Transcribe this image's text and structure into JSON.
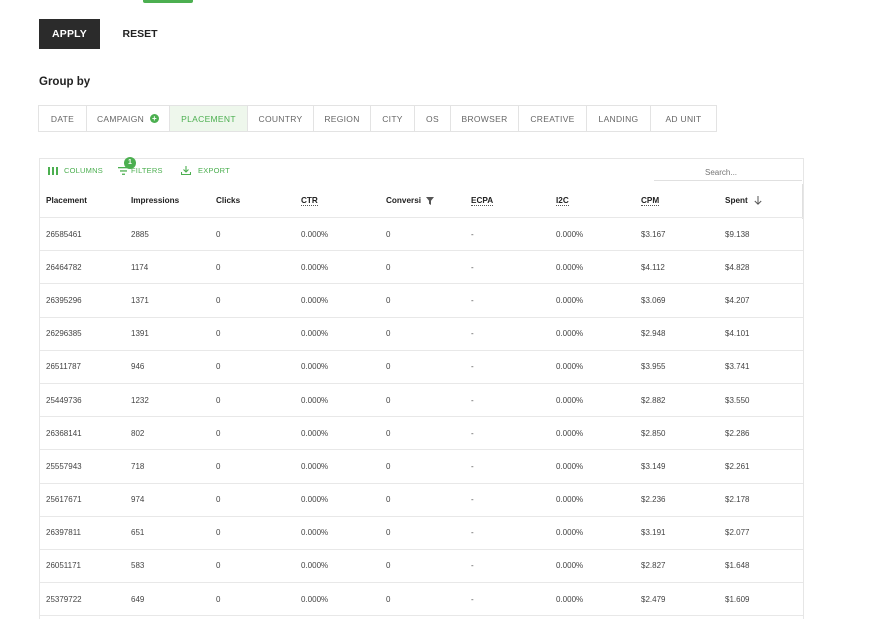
{
  "actions": {
    "apply": "APPLY",
    "reset": "RESET"
  },
  "group_by": {
    "label": "Group by",
    "tabs": [
      "DATE",
      "CAMPAIGN",
      "PLACEMENT",
      "COUNTRY",
      "REGION",
      "CITY",
      "OS",
      "BROWSER",
      "CREATIVE",
      "LANDING",
      "AD UNIT"
    ],
    "active": "PLACEMENT"
  },
  "toolbar": {
    "columns": "COLUMNS",
    "filters": "FILTERS",
    "filters_badge": "1",
    "export": "EXPORT",
    "search_placeholder": "Search..."
  },
  "table": {
    "headers": [
      "Placement",
      "Impressions",
      "Clicks",
      "CTR",
      "Conversi",
      "ECPA",
      "I2C",
      "CPM",
      "Spent"
    ],
    "rows": [
      [
        "26585461",
        "2885",
        "0",
        "0.000%",
        "0",
        "-",
        "0.000%",
        "$3.167",
        "$9.138"
      ],
      [
        "26464782",
        "1174",
        "0",
        "0.000%",
        "0",
        "-",
        "0.000%",
        "$4.112",
        "$4.828"
      ],
      [
        "26395296",
        "1371",
        "0",
        "0.000%",
        "0",
        "-",
        "0.000%",
        "$3.069",
        "$4.207"
      ],
      [
        "26296385",
        "1391",
        "0",
        "0.000%",
        "0",
        "-",
        "0.000%",
        "$2.948",
        "$4.101"
      ],
      [
        "26511787",
        "946",
        "0",
        "0.000%",
        "0",
        "-",
        "0.000%",
        "$3.955",
        "$3.741"
      ],
      [
        "25449736",
        "1232",
        "0",
        "0.000%",
        "0",
        "-",
        "0.000%",
        "$2.882",
        "$3.550"
      ],
      [
        "26368141",
        "802",
        "0",
        "0.000%",
        "0",
        "-",
        "0.000%",
        "$2.850",
        "$2.286"
      ],
      [
        "25557943",
        "718",
        "0",
        "0.000%",
        "0",
        "-",
        "0.000%",
        "$3.149",
        "$2.261"
      ],
      [
        "25617671",
        "974",
        "0",
        "0.000%",
        "0",
        "-",
        "0.000%",
        "$2.236",
        "$2.178"
      ],
      [
        "26397811",
        "651",
        "0",
        "0.000%",
        "0",
        "-",
        "0.000%",
        "$3.191",
        "$2.077"
      ],
      [
        "26051171",
        "583",
        "0",
        "0.000%",
        "0",
        "-",
        "0.000%",
        "$2.827",
        "$1.648"
      ],
      [
        "25379722",
        "649",
        "0",
        "0.000%",
        "0",
        "-",
        "0.000%",
        "$2.479",
        "$1.609"
      ]
    ]
  },
  "colors": {
    "accent": "#4caf50",
    "apply_bg": "#2b2b2b",
    "active_tab_bg": "#eef7ec"
  }
}
